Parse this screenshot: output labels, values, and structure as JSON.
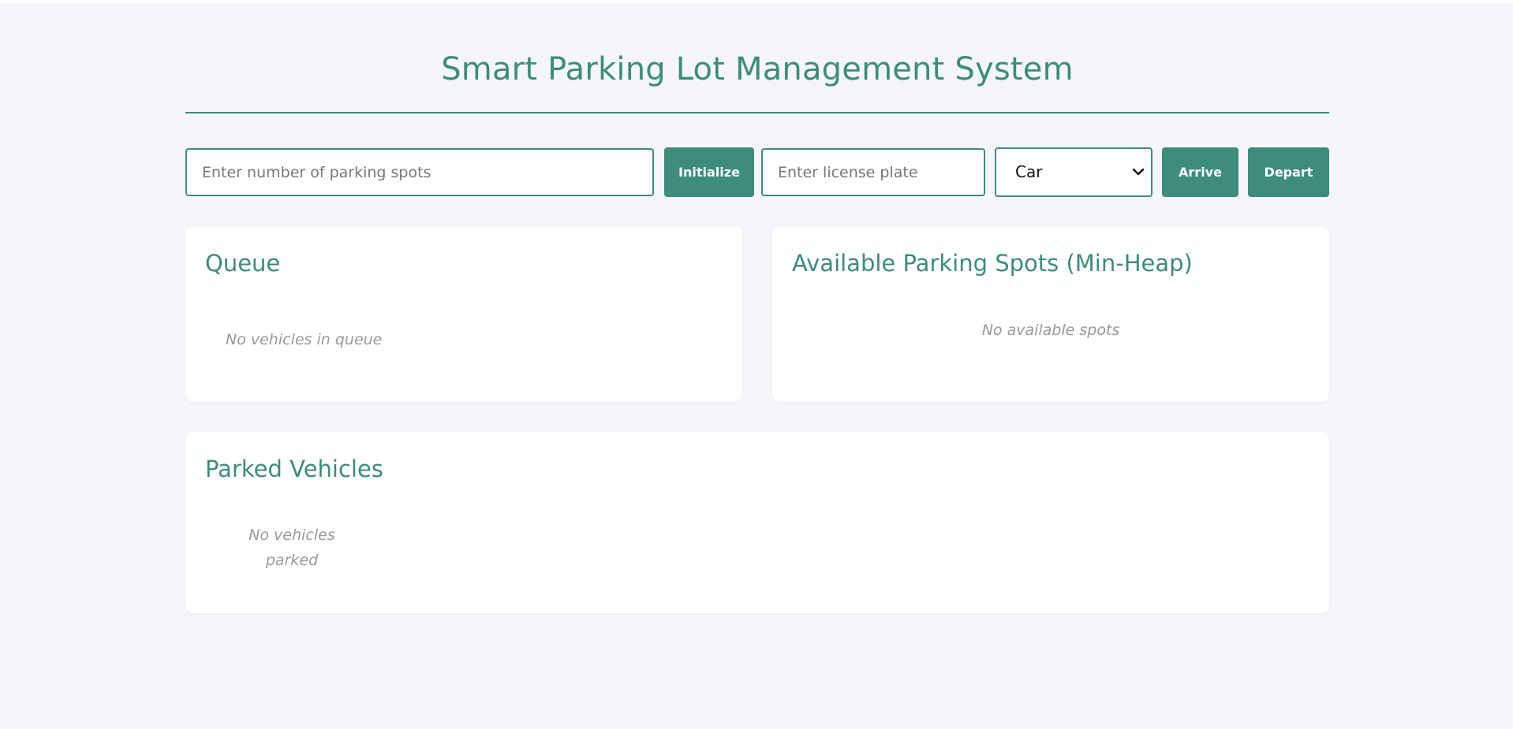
{
  "header": {
    "title": "Smart Parking Lot Management System"
  },
  "controls": {
    "spots_placeholder": "Enter number of parking spots",
    "spots_value": "",
    "initialize_label": "Initialize",
    "plate_placeholder": "Enter license plate",
    "plate_value": "",
    "vehicle_type_selected": "Car",
    "arrive_label": "Arrive",
    "depart_label": "Depart"
  },
  "queue": {
    "title": "Queue",
    "empty_text": "No vehicles in queue"
  },
  "spots": {
    "title": "Available Parking Spots (Min-Heap)",
    "empty_text": "No available spots"
  },
  "parked": {
    "title": "Parked Vehicles",
    "empty_text": "No vehicles parked"
  },
  "colors": {
    "accent": "#3d8c7c",
    "background": "#f5f6fa",
    "card": "#ffffff",
    "muted_text": "#999999"
  },
  "icons": {
    "select_arrow": "chevron-down-icon"
  }
}
